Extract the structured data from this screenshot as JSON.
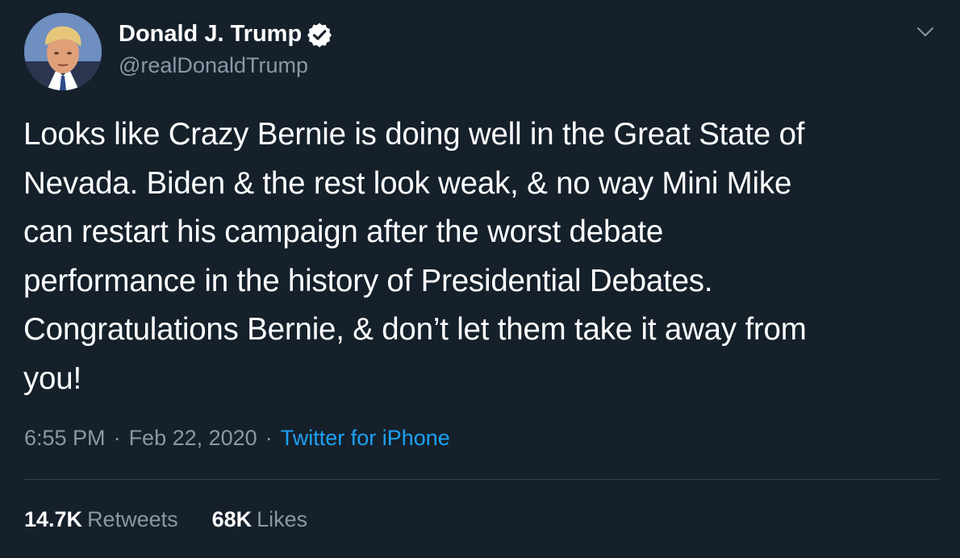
{
  "author": {
    "display_name": "Donald J. Trump",
    "handle": "@realDonaldTrump",
    "verified": true,
    "avatar_icon": "profile-photo"
  },
  "tweet": {
    "text": "Looks like Crazy Bernie is doing well in the Great State of\nNevada. Biden & the rest look weak, & no way Mini Mike\ncan restart his campaign after the worst debate\nperformance in the history of Presidential Debates.\nCongratulations Bernie, & don’t let them take it away from\nyou!"
  },
  "meta": {
    "time": "6:55 PM",
    "separator": "·",
    "date": "Feb 22, 2020",
    "source": "Twitter for iPhone"
  },
  "stats": {
    "retweets_count": "14.7K",
    "retweets_label": "Retweets",
    "likes_count": "68K",
    "likes_label": "Likes"
  },
  "colors": {
    "background": "#15202b",
    "text": "#ffffff",
    "muted": "#8899a6",
    "link": "#1da1f2",
    "divider": "#38444d"
  }
}
